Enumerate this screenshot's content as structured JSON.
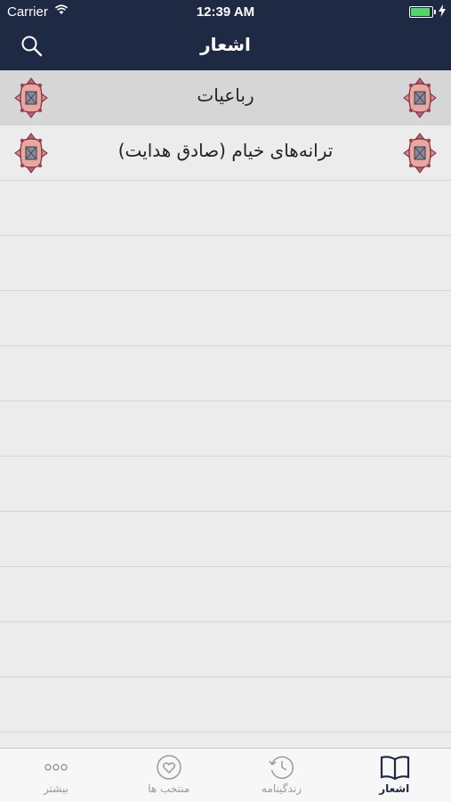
{
  "status_bar": {
    "carrier": "Carrier",
    "time": "12:39 AM",
    "battery_percent": 100
  },
  "nav": {
    "title": "اشعار",
    "search_icon": "search-icon"
  },
  "list": {
    "rows": [
      {
        "label": "رباعیات",
        "selected": true
      },
      {
        "label": "ترانه‌های خیام (صادق هدایت)",
        "selected": false
      }
    ],
    "empty_rows": 10
  },
  "tabs": [
    {
      "label": "بیشتر",
      "icon": "more-icon",
      "active": false
    },
    {
      "label": "منتخب ها",
      "icon": "heart-icon",
      "active": false
    },
    {
      "label": "زندگینامه",
      "icon": "history-clock-icon",
      "active": false
    },
    {
      "label": "اشعار",
      "icon": "book-icon",
      "active": true
    }
  ],
  "colors": {
    "bar": "#1e2a44",
    "accent": "#1e2a44",
    "inactive": "#9a9a9a",
    "battery": "#4cd964"
  }
}
